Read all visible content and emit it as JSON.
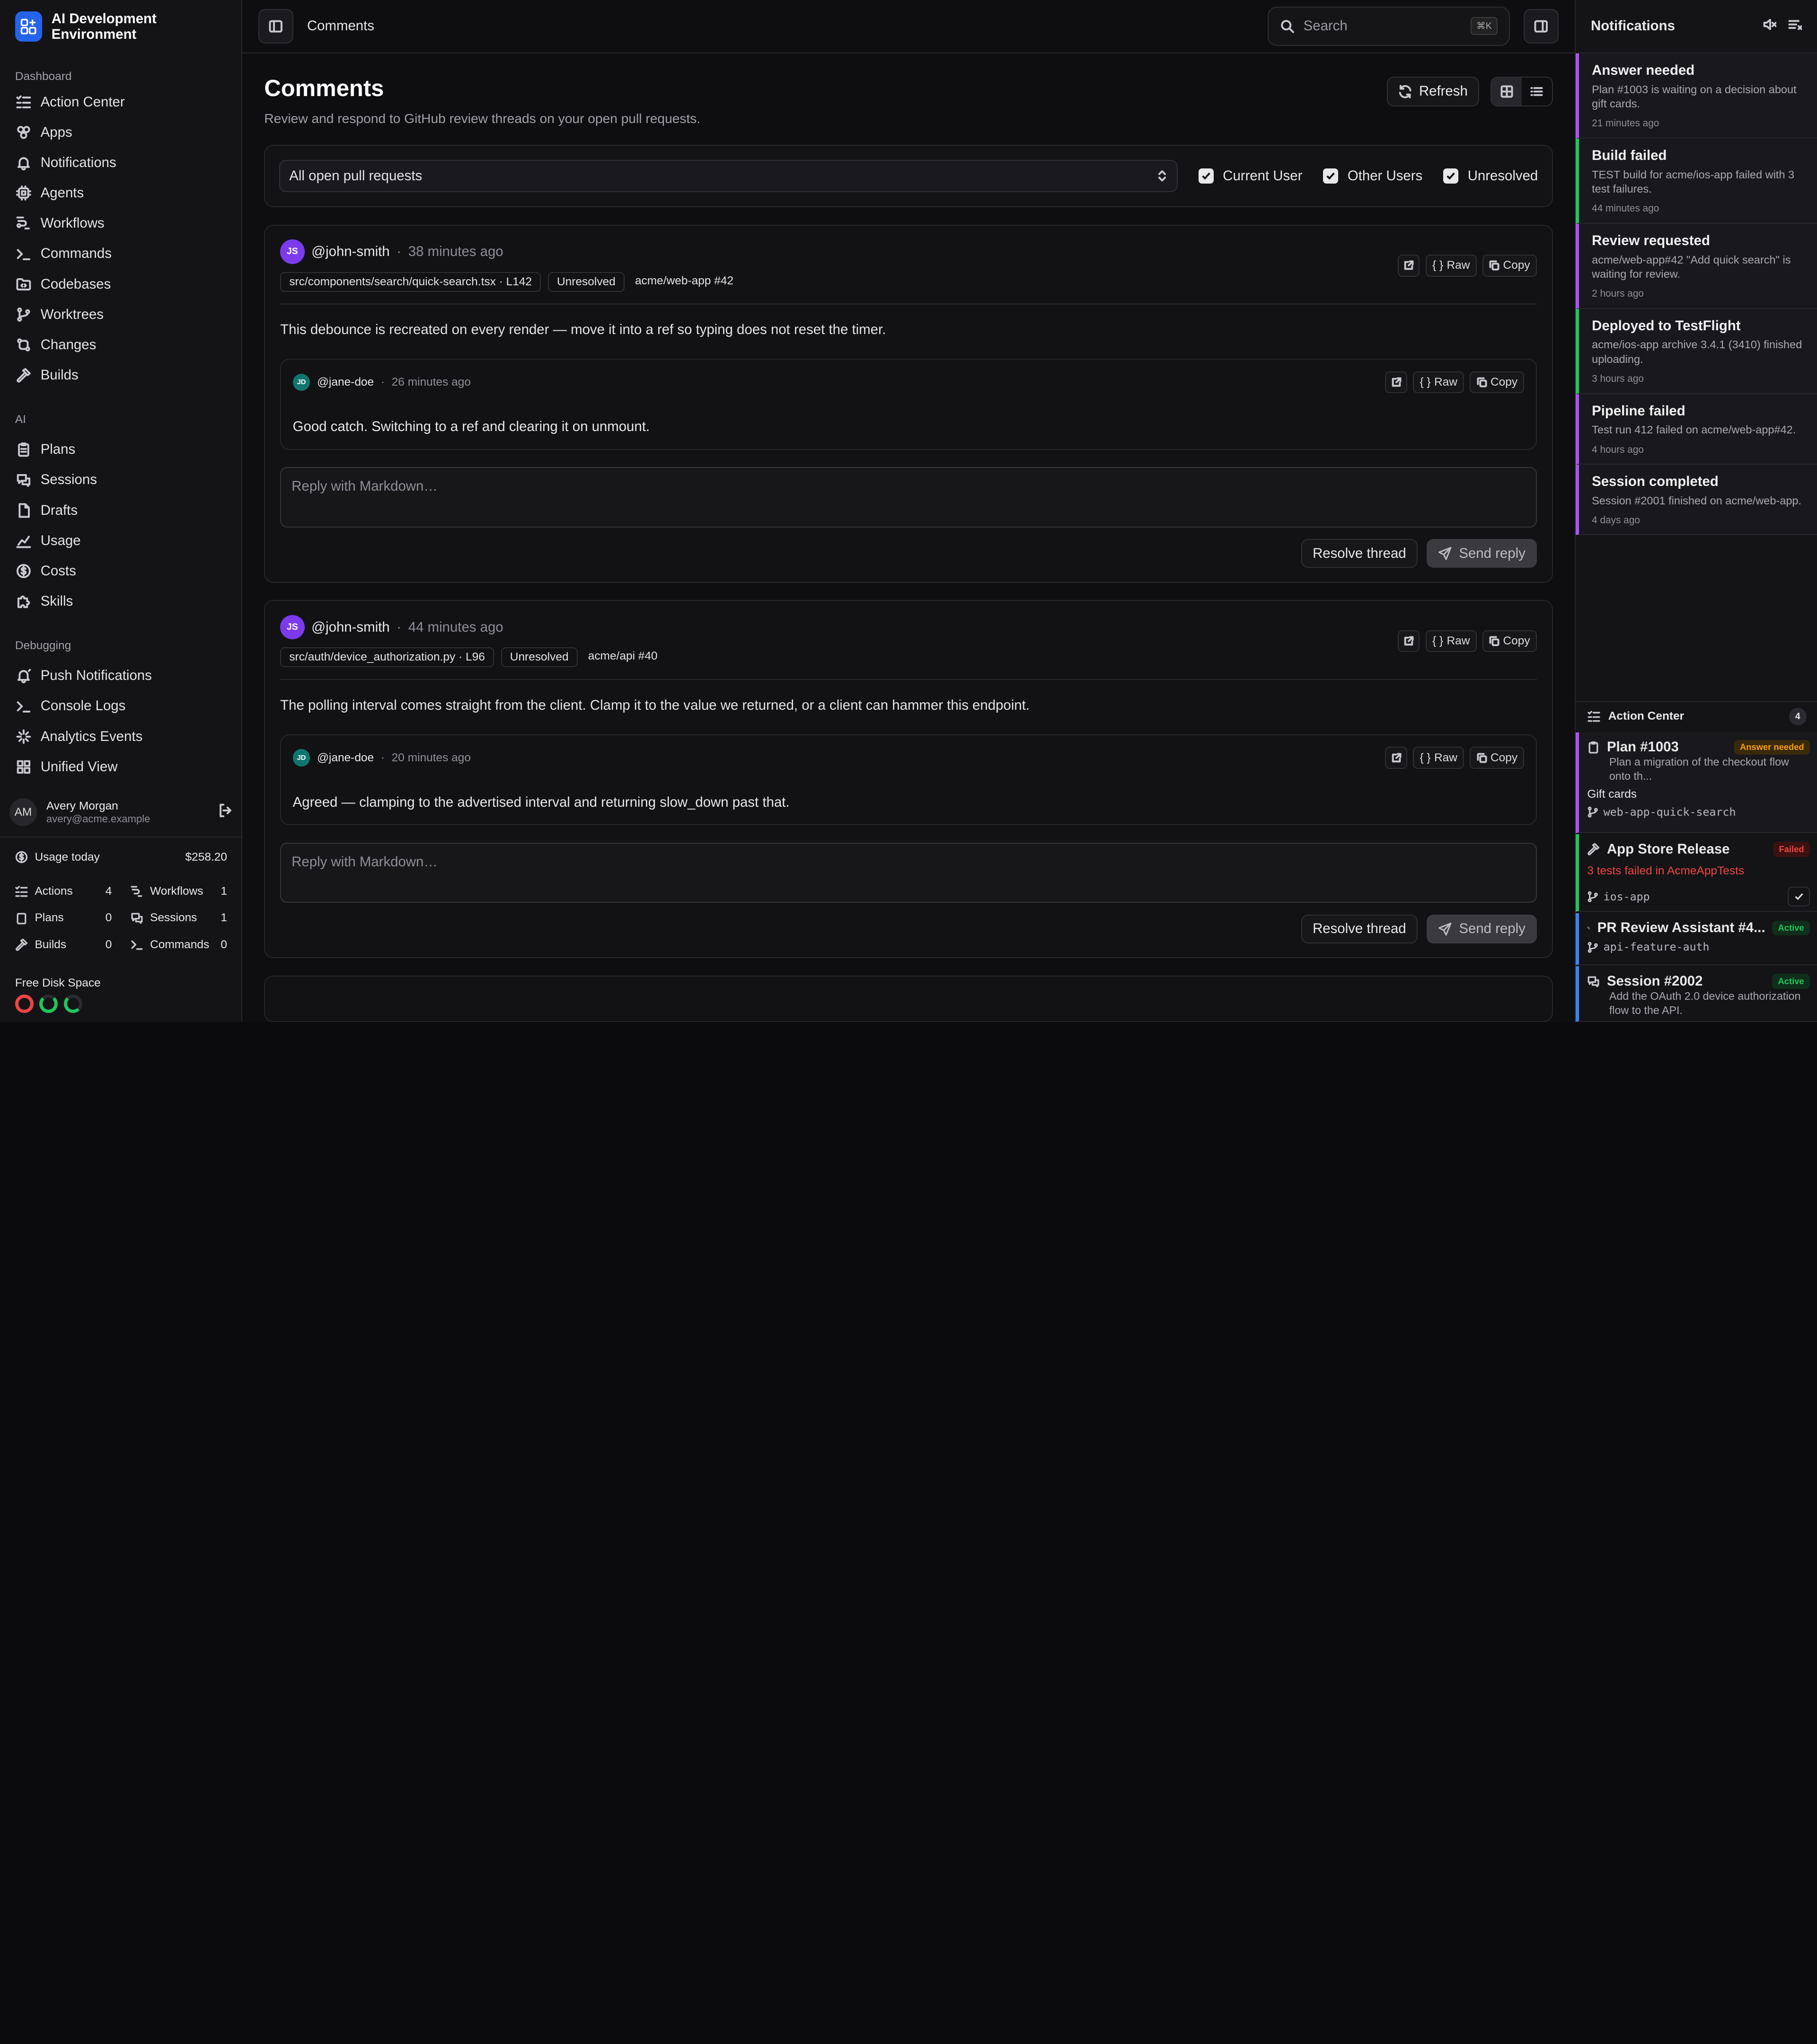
{
  "app": {
    "name": "AI Development Environment"
  },
  "sidebar": {
    "sections": [
      {
        "label": "Dashboard",
        "items": [
          "Action Center",
          "Apps",
          "Notifications",
          "Agents",
          "Workflows",
          "Commands",
          "Codebases",
          "Worktrees",
          "Changes",
          "Builds"
        ]
      },
      {
        "label": "AI",
        "items": [
          "Plans",
          "Sessions",
          "Drafts",
          "Usage",
          "Costs",
          "Skills"
        ]
      },
      {
        "label": "Debugging",
        "items": [
          "Push Notifications",
          "Console Logs",
          "Analytics Events",
          "Unified View"
        ]
      }
    ],
    "user": {
      "initials": "AM",
      "name": "Avery Morgan",
      "email": "avery@acme.example"
    },
    "usage": {
      "label": "Usage today",
      "amount": "$258.20",
      "stats": [
        {
          "label": "Actions",
          "value": "4"
        },
        {
          "label": "Workflows",
          "value": "1"
        },
        {
          "label": "Plans",
          "value": "0"
        },
        {
          "label": "Sessions",
          "value": "1"
        },
        {
          "label": "Builds",
          "value": "0"
        },
        {
          "label": "Commands",
          "value": "0"
        }
      ]
    },
    "disk": {
      "label": "Free Disk Space",
      "colors": [
        "#ef4444",
        "#22c55e",
        "#22c55e"
      ]
    }
  },
  "topbar": {
    "breadcrumb": "Comments",
    "search_placeholder": "Search",
    "shortcut": "⌘K"
  },
  "page": {
    "title": "Comments",
    "subtitle": "Review and respond to GitHub review threads on your open pull requests.",
    "refresh_label": "Refresh",
    "filter": {
      "select_value": "All open pull requests",
      "checks": [
        "Current User",
        "Other Users",
        "Unresolved"
      ]
    }
  },
  "threads": [
    {
      "author_initials": "JS",
      "author": "@john-smith",
      "time": "38 minutes ago",
      "file": "src/components/search/quick-search.tsx · L142",
      "status": "Unresolved",
      "repo": "acme/web-app #42",
      "body": "This debounce is recreated on every render — move it into a ref so typing does not reset the timer.",
      "reply": {
        "initials": "JD",
        "author": "@jane-doe",
        "time": "26 minutes ago",
        "body": "Good catch. Switching to a ref and clearing it on unmount."
      },
      "placeholder": "Reply with Markdown…"
    },
    {
      "author_initials": "JS",
      "author": "@john-smith",
      "time": "44 minutes ago",
      "file": "src/auth/device_authorization.py · L96",
      "status": "Unresolved",
      "repo": "acme/api #40",
      "body": "The polling interval comes straight from the client. Clamp it to the value we returned, or a client can hammer this endpoint.",
      "reply": {
        "initials": "JD",
        "author": "@jane-doe",
        "time": "20 minutes ago",
        "body": "Agreed — clamping to the advertised interval and returning slow_down past that."
      },
      "placeholder": "Reply with Markdown…"
    }
  ],
  "labels": {
    "raw": "Raw",
    "copy": "Copy",
    "resolve": "Resolve thread",
    "send": "Send reply",
    "sep": "·"
  },
  "notifications": {
    "title": "Notifications",
    "items": [
      {
        "title": "Answer needed",
        "desc": "Plan #1003 is waiting on a decision about gift cards.",
        "time": "21 minutes ago",
        "color": "#a855f7"
      },
      {
        "title": "Build failed",
        "desc": "TEST build for acme/ios-app failed with 3 test failures.",
        "time": "44 minutes ago",
        "color": "#22c55e"
      },
      {
        "title": "Review requested",
        "desc": "acme/web-app#42 \"Add quick search\" is waiting for review.",
        "time": "2 hours ago",
        "color": "#a855f7"
      },
      {
        "title": "Deployed to TestFlight",
        "desc": "acme/ios-app archive 3.4.1 (3410) finished uploading.",
        "time": "3 hours ago",
        "color": "#22c55e"
      },
      {
        "title": "Pipeline failed",
        "desc": "Test run 412 failed on acme/web-app#42.",
        "time": "4 hours ago",
        "color": "#a855f7"
      },
      {
        "title": "Session completed",
        "desc": "Session #2001 finished on acme/web-app.",
        "time": "4 days ago",
        "color": "#a855f7"
      }
    ]
  },
  "action_center": {
    "title": "Action Center",
    "count": "4",
    "items": [
      {
        "title": "Plan #1003",
        "badge": "Answer needed",
        "badge_color": "#f59e0b",
        "desc": "Plan a migration of the checkout flow onto th...",
        "line": "Gift cards",
        "branch": "web-app-quick-search",
        "color": "#a855f7"
      },
      {
        "title": "App Store Release",
        "badge": "Failed",
        "badge_color": "#ef4444",
        "line": "3 tests failed in AcmeAppTests",
        "branch": "ios-app",
        "color": "#22c55e"
      },
      {
        "title": "PR Review Assistant #4...",
        "badge": "Active",
        "badge_color": "#22c55e",
        "branch": "api-feature-auth",
        "color": "#3b82f6"
      },
      {
        "title": "Session #2002",
        "badge": "Active",
        "badge_color": "#22c55e",
        "desc": "Add the OAuth 2.0 device authorization flow to the API.",
        "color": "#3b82f6"
      }
    ]
  }
}
